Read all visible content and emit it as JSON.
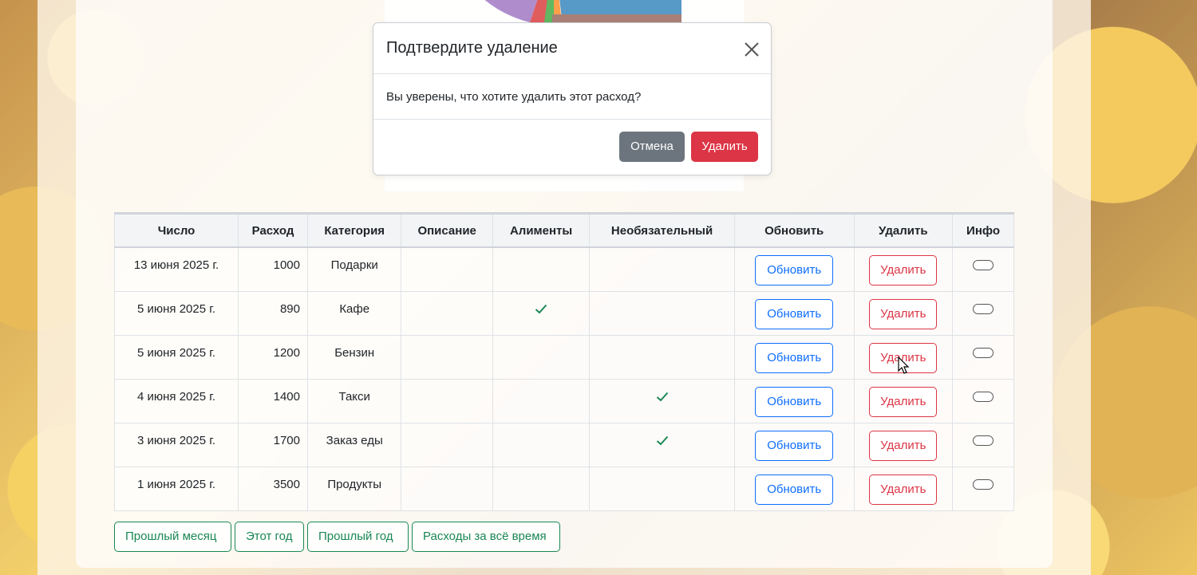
{
  "table": {
    "headers": [
      "Число",
      "Расход",
      "Категория",
      "Описание",
      "Алименты",
      "Необязательный",
      "Обновить",
      "Удалить",
      "Инфо"
    ],
    "rows": [
      {
        "date": "13 июня 2025 г.",
        "amount": "1000",
        "category": "Подарки",
        "description": "",
        "alimony": false,
        "optional": false
      },
      {
        "date": "5 июня 2025 г.",
        "amount": "890",
        "category": "Кафе",
        "description": "",
        "alimony": true,
        "optional": false
      },
      {
        "date": "5 июня 2025 г.",
        "amount": "1200",
        "category": "Бензин",
        "description": "",
        "alimony": false,
        "optional": false
      },
      {
        "date": "4 июня 2025 г.",
        "amount": "1400",
        "category": "Такси",
        "description": "",
        "alimony": false,
        "optional": true
      },
      {
        "date": "3 июня 2025 г.",
        "amount": "1700",
        "category": "Заказ еды",
        "description": "",
        "alimony": false,
        "optional": true
      },
      {
        "date": "1 июня 2025 г.",
        "amount": "3500",
        "category": "Продукты",
        "description": "",
        "alimony": false,
        "optional": false
      }
    ],
    "update_label": "Обновить",
    "delete_label": "Удалить"
  },
  "period_buttons": [
    "Прошлый месяц",
    "Этот год",
    "Прошлый год",
    "Расходы за всё время"
  ],
  "modal": {
    "title": "Подтвердите удаление",
    "body": "Вы уверены, что хотите удалить этот расход?",
    "cancel_label": "Отмена",
    "confirm_label": "Удалить",
    "close_icon": "close-icon"
  },
  "colors": {
    "primary": "#0d6efd",
    "danger": "#dc3545",
    "success": "#198754",
    "secondary": "#6c757d",
    "check": "#198754"
  },
  "pie_chart": {
    "visible_slice_colors": [
      "#9467bd",
      "#d62728",
      "#2ca02c",
      "#ff7f0e",
      "#1f77b4",
      "#8c564b"
    ]
  }
}
